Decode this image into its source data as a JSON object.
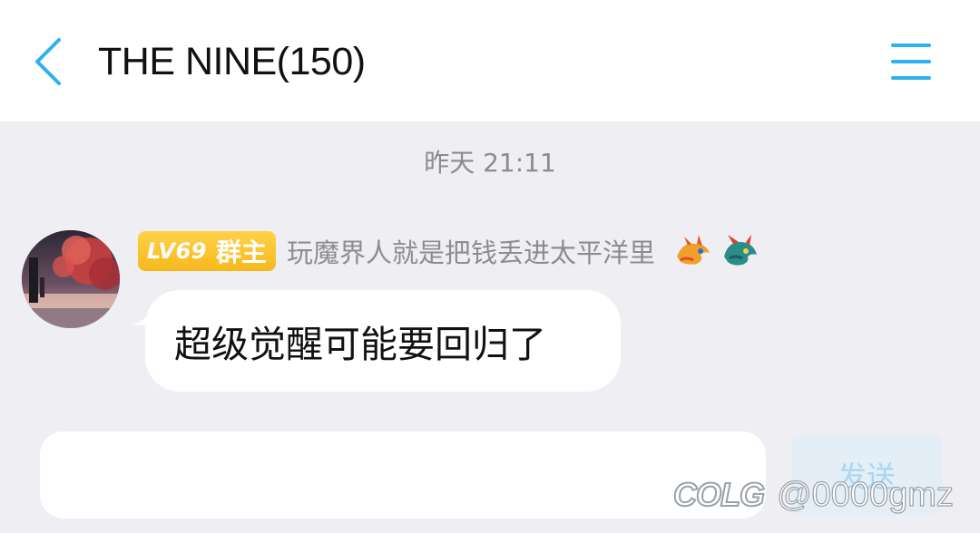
{
  "header": {
    "title": "THE NINE(150)",
    "back_icon": "chevron-left-icon",
    "menu_icon": "hamburger-menu-icon",
    "accent_color": "#2fb0ef"
  },
  "chat": {
    "timestamp": "昨天 21:11",
    "messages": [
      {
        "sender": {
          "level_badge": "LV69",
          "role_badge": "群主",
          "name": "玩魔界人就是把钱丢进太平洋里",
          "badge_color": "#f7b81c",
          "emblems": [
            "dragon-fire-icon",
            "dragon-teal-icon"
          ]
        },
        "text": "超级觉醒可能要回归了"
      }
    ]
  },
  "composer": {
    "input_value": "",
    "send_label": "发送"
  },
  "watermark": {
    "logo": "COLG",
    "handle": "@0000gmz"
  }
}
